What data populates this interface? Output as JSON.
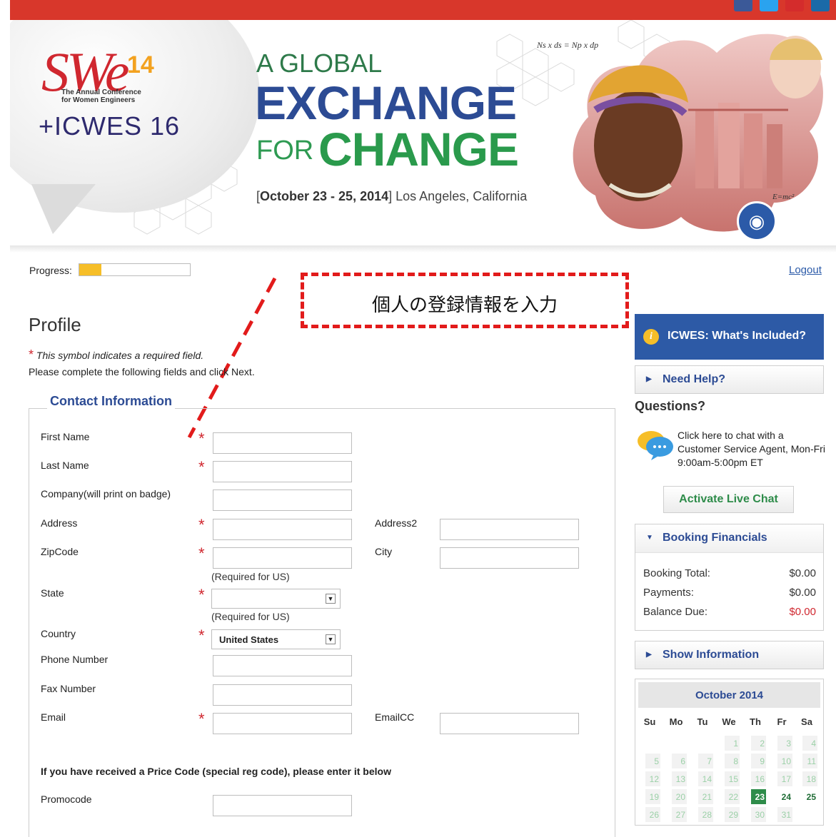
{
  "header": {
    "logo_we": "We",
    "logo_we_prefix": "S",
    "logo_number": "14",
    "logo_subtitle_1": "The Annual Conference",
    "logo_subtitle_2": "for Women Engineers",
    "logo_icwes": "+ICWES 16",
    "headline_1": "A GLOBAL",
    "headline_2": "EXCHANGE",
    "headline_3a": "FOR",
    "headline_3b": "CHANGE",
    "dates": "October 23 - 25, 2014",
    "location": "Los Angeles, California",
    "formula_1": "Ns x ds = Np x dp",
    "formula_2": "E=mc²"
  },
  "progress": {
    "label": "Progress:",
    "value_fraction": 0.2
  },
  "logout_label": "Logout",
  "annotation": {
    "text": "個人の登録情報を入力",
    "color": "#e21b1b"
  },
  "page": {
    "title": "Profile",
    "required_note": "This symbol indicates a required field.",
    "instructions": "Please complete the following fields and click Next.",
    "section_title": "Contact Information"
  },
  "form": {
    "first_name": "First Name",
    "last_name": "Last Name",
    "company": "Company(will print on badge)",
    "address": "Address",
    "address2": "Address2",
    "zipcode": "ZipCode",
    "city": "City",
    "required_for_us": "(Required for US)",
    "state": "State",
    "state_value": "",
    "country": "Country",
    "country_value": "United States",
    "phone": "Phone Number",
    "fax": "Fax Number",
    "email": "Email",
    "emailcc": "EmailCC",
    "promo_heading": "If you have received a Price Code (special reg code), please enter it below",
    "promocode": "Promocode"
  },
  "sidebar": {
    "whats_included": "ICWES: What's Included?",
    "need_help": "Need Help?",
    "questions": "Questions?",
    "chat_text": "Click here to chat with a Customer Service Agent, Mon-Fri 9:00am-5:00pm ET",
    "live_chat": "Activate Live Chat",
    "booking_title": "Booking Financials",
    "booking_total_label": "Booking Total:",
    "booking_total": "$0.00",
    "payments_label": "Payments:",
    "payments": "$0.00",
    "balance_label": "Balance Due:",
    "balance": "$0.00",
    "show_information": "Show Information"
  },
  "calendar": {
    "month": "October 2014",
    "dow": [
      "Su",
      "Mo",
      "Tu",
      "We",
      "Th",
      "Fr",
      "Sa"
    ],
    "weeks": [
      [
        "",
        "",
        "",
        "1",
        "2",
        "3",
        "4"
      ],
      [
        "5",
        "6",
        "7",
        "8",
        "9",
        "10",
        "11"
      ],
      [
        "12",
        "13",
        "14",
        "15",
        "16",
        "17",
        "18"
      ],
      [
        "19",
        "20",
        "21",
        "22",
        "23",
        "24",
        "25"
      ],
      [
        "26",
        "27",
        "28",
        "29",
        "30",
        "31",
        ""
      ]
    ],
    "today": "23",
    "future_days": [
      "24",
      "25"
    ]
  },
  "colors": {
    "brand_red": "#d8372b",
    "brand_blue": "#2d5aa6",
    "brand_green": "#2e8c4a",
    "required_red": "#d0272f",
    "progress_yellow": "#f6be28"
  }
}
